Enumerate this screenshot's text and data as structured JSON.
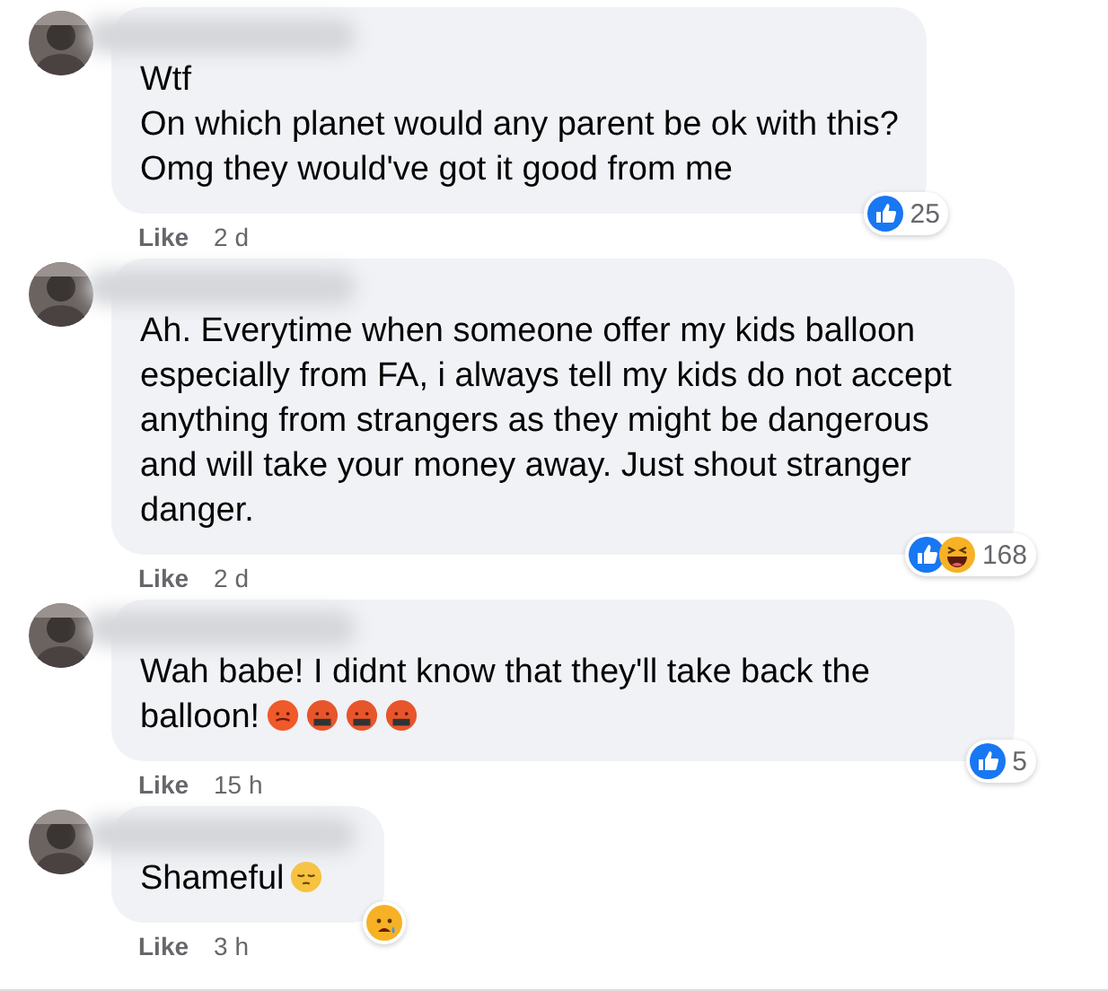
{
  "comments": [
    {
      "paragraphs": [
        "Wtf",
        "On which planet would any parent be ok with this?",
        "Omg they would've got it good from me"
      ],
      "reactions": [
        {
          "kind": "like"
        }
      ],
      "reaction_count": "25",
      "like_label": "Like",
      "time": "2 d"
    },
    {
      "paragraphs": [
        "Ah. Everytime when someone offer my kids balloon especially from FA, i always tell my kids do not accept anything from strangers as they might be dangerous and will take your money away. Just shout stranger danger."
      ],
      "reactions": [
        {
          "kind": "like"
        },
        {
          "kind": "haha"
        }
      ],
      "reaction_count": "168",
      "like_label": "Like",
      "time": "2 d"
    },
    {
      "paragraphs": [
        "Wah babe! I didnt know that they'll take back the balloon!"
      ],
      "emojis": [
        {
          "kind": "angry"
        },
        {
          "kind": "cursing"
        },
        {
          "kind": "cursing"
        },
        {
          "kind": "cursing"
        }
      ],
      "reactions": [
        {
          "kind": "like"
        }
      ],
      "reaction_count": "5",
      "like_label": "Like",
      "time": "15 h"
    },
    {
      "paragraphs": [
        "Shameful"
      ],
      "emojis": [
        {
          "kind": "pensive"
        }
      ],
      "reactions": [
        {
          "kind": "sad"
        }
      ],
      "like_label": "Like",
      "time": "3 h"
    }
  ]
}
